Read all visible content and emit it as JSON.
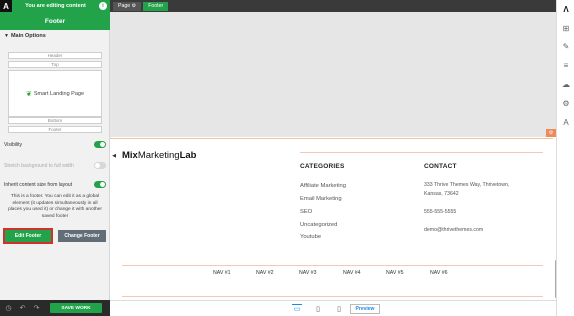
{
  "editbar": {
    "logo": "A",
    "text": "You are editing content",
    "info": "i"
  },
  "panel": {
    "title": "Footer",
    "main_options": "Main Options",
    "bars": {
      "header": "Header",
      "top": "Top",
      "bottom": "Bottom",
      "footer": "Footer"
    },
    "preview_label": "Smart Landing Page",
    "options": [
      {
        "label": "Visibility",
        "on": true
      },
      {
        "label": "Stretch background to full width",
        "on": false
      },
      {
        "label": "Inherit content size from layout",
        "on": true
      }
    ],
    "global_note": "This is a footer. You can edit it as a global element (it updates simultaneously in all places you used it) or change it with another saved footer",
    "edit_button": "Edit Footer",
    "change_button": "Change Footer",
    "save_button": "SAVE WORK"
  },
  "breadcrumb": {
    "page": "Page",
    "footer": "Footer"
  },
  "footer_content": {
    "brand_light": "Mix",
    "brand_mid": "Marketing",
    "brand_bold": "Lab",
    "categories_heading": "CATEGORIES",
    "categories": [
      "Affiliate Marketing",
      "Email Marketing",
      "SEO",
      "Uncategorized",
      "Youtube"
    ],
    "contact_heading": "CONTACT",
    "contact_address": [
      "333 Thrive Themes Way, Thrivetown,",
      "Kansas, 73642"
    ],
    "contact_phone": "555-555-5555",
    "contact_email": "demo@thrivethemes.com",
    "nav": [
      "NAV #1",
      "NAV #2",
      "NAV #3",
      "NAV #4",
      "NAV #5",
      "NAV #6"
    ]
  },
  "devicebar": {
    "preview": "Preview"
  },
  "icons": {
    "right": [
      "thrive-logo-icon",
      "add-element-icon",
      "brush-icon",
      "align-icon",
      "cloud-icon",
      "settings-icon",
      "typography-icon"
    ]
  }
}
